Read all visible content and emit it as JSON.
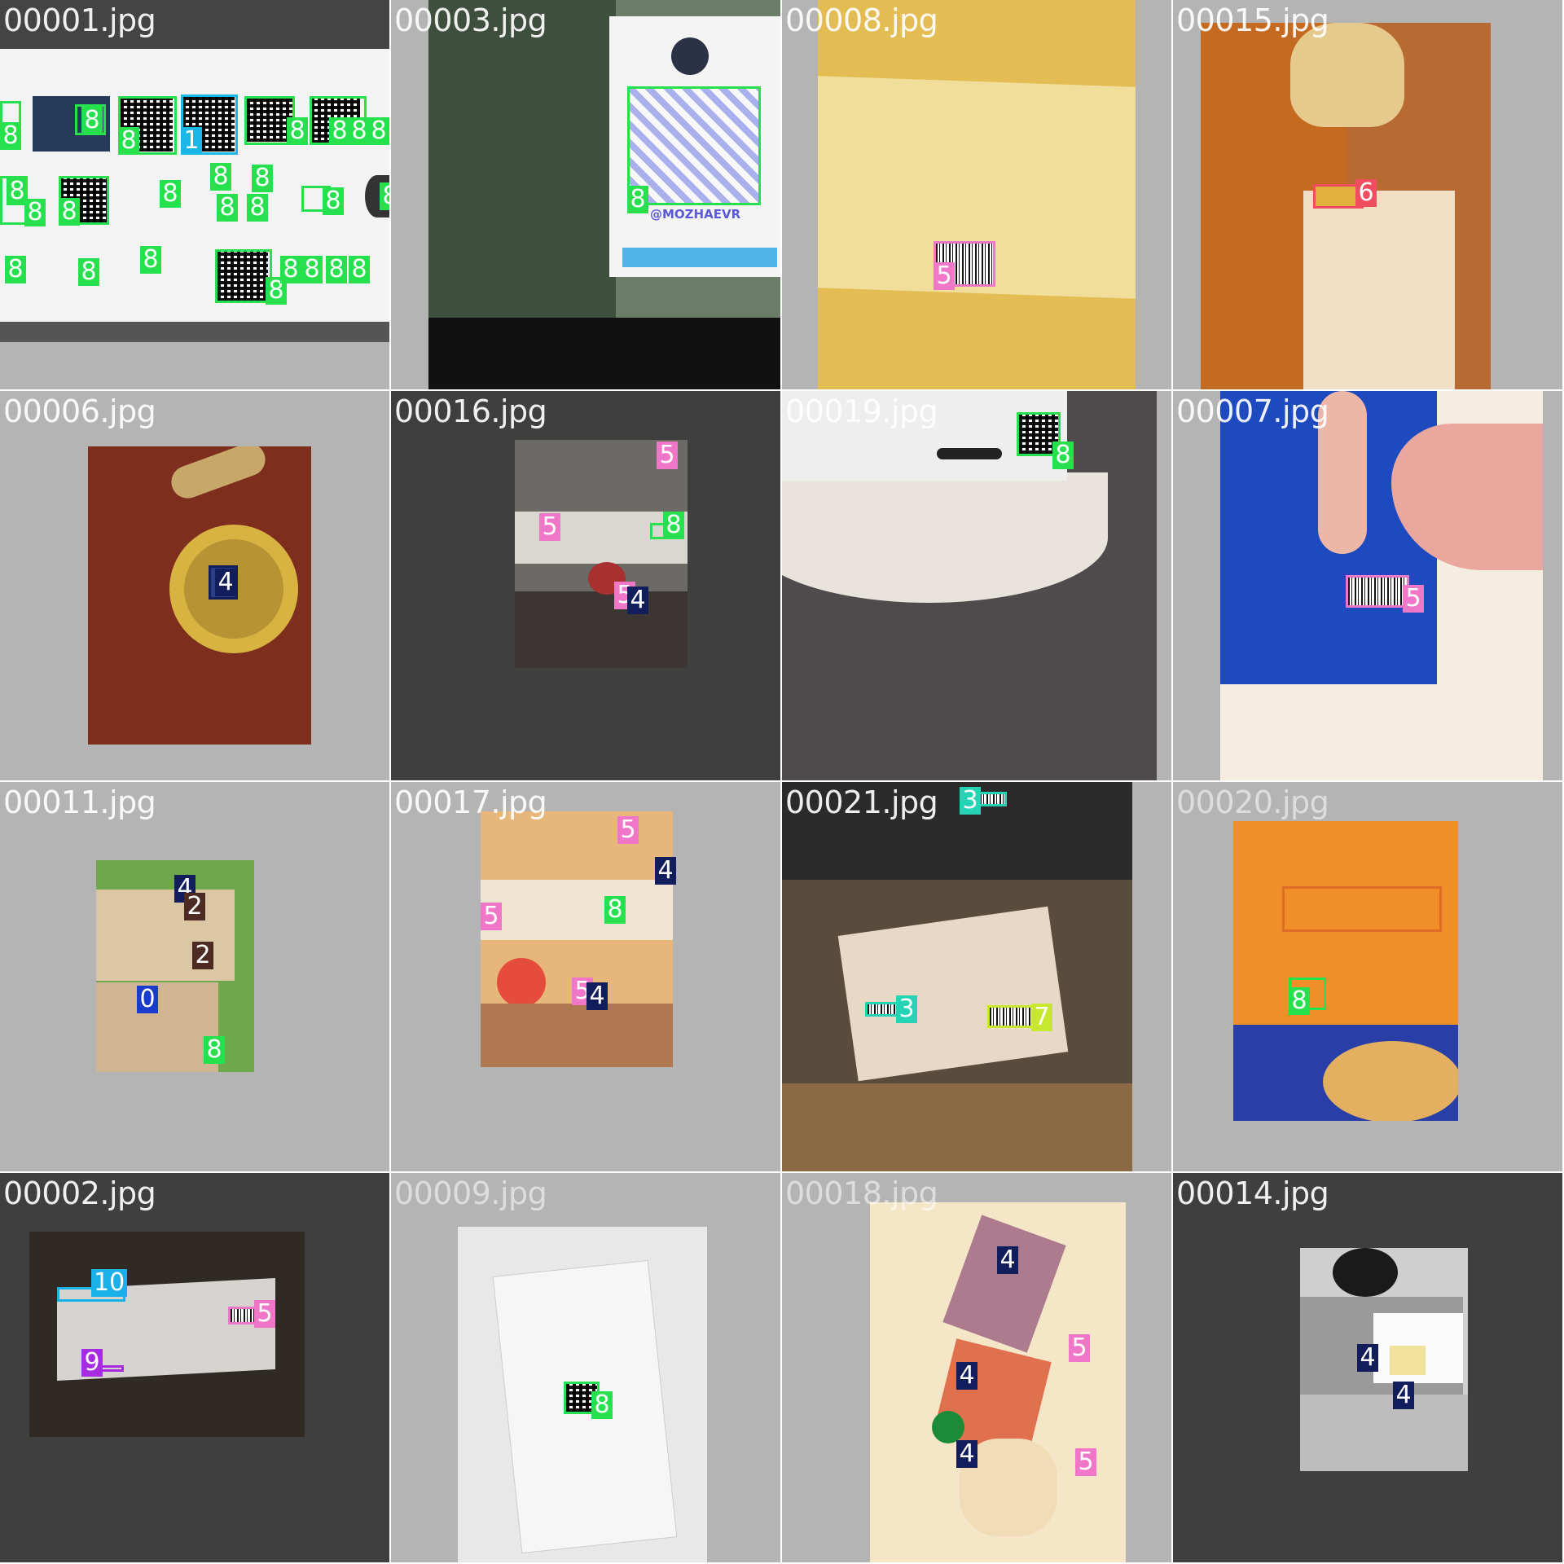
{
  "tiles": [
    {
      "filename": "00001.jpg",
      "labels": [
        "8",
        "8",
        "8",
        "8",
        "1",
        "8",
        "8",
        "8",
        "8",
        "8",
        "8",
        "8",
        "8",
        "8",
        "8",
        "8",
        "8",
        "8",
        "8",
        "8",
        "8",
        "8",
        "8",
        "8",
        "8",
        "8"
      ]
    },
    {
      "filename": "00003.jpg",
      "labels": [
        "8"
      ],
      "ui_text": "@MOZHAEVR"
    },
    {
      "filename": "00008.jpg",
      "labels": [
        "5"
      ]
    },
    {
      "filename": "00015.jpg",
      "labels": [
        "6"
      ]
    },
    {
      "filename": "00006.jpg",
      "labels": [
        "4"
      ]
    },
    {
      "filename": "00016.jpg",
      "labels": [
        "5",
        "5",
        "8",
        "5",
        "4"
      ]
    },
    {
      "filename": "00019.jpg",
      "labels": [
        "8"
      ]
    },
    {
      "filename": "00007.jpg",
      "labels": [
        "5"
      ]
    },
    {
      "filename": "00011.jpg",
      "labels": [
        "4",
        "2",
        "2",
        "0",
        "8"
      ]
    },
    {
      "filename": "00017.jpg",
      "labels": [
        "5",
        "4",
        "5",
        "8",
        "5",
        "4"
      ]
    },
    {
      "filename": "00021.jpg",
      "labels": [
        "3",
        "3",
        "7"
      ]
    },
    {
      "filename": "00020.jpg",
      "labels": [
        "8"
      ]
    },
    {
      "filename": "00002.jpg",
      "labels": [
        "10",
        "5",
        "9"
      ]
    },
    {
      "filename": "00009.jpg",
      "labels": [
        "8"
      ]
    },
    {
      "filename": "00018.jpg",
      "labels": [
        "4",
        "5",
        "4",
        "4",
        "5"
      ]
    },
    {
      "filename": "00014.jpg",
      "labels": [
        "4",
        "4"
      ]
    }
  ],
  "colors": {
    "class_0": "#1a3ccc",
    "class_1": "#1ab8e6",
    "class_2": "#4d2b23",
    "class_3": "#24d4b4",
    "class_4": "#121d5c",
    "class_5": "#f077c8",
    "class_6": "#f04e5e",
    "class_7": "#c8e830",
    "class_8": "#26e04e",
    "class_9": "#a62ce0",
    "class_10": "#1ab0e8"
  }
}
